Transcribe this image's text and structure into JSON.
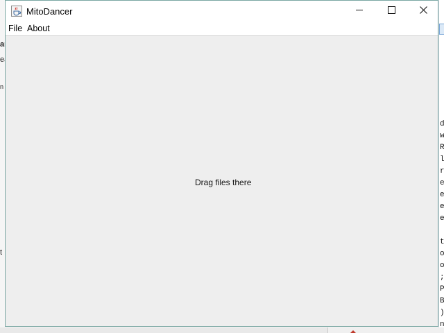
{
  "window": {
    "title": "MitoDancer",
    "app_icon": "java-cup-icon",
    "controls": {
      "minimize_icon": "minimize-icon",
      "maximize_icon": "maximize-icon",
      "close_icon": "close-icon"
    }
  },
  "menu": {
    "items": [
      {
        "label": "File"
      },
      {
        "label": "About"
      }
    ]
  },
  "main": {
    "drop_hint": "Drag files there"
  },
  "background": {
    "left_fragments": [
      "ar",
      "ea",
      "n",
      "t"
    ],
    "right_code_chars": [
      "d",
      "w",
      "R",
      "l",
      "r",
      "e",
      "e",
      "e",
      "e",
      "t",
      "o",
      "o",
      ";",
      "P",
      "B",
      ")",
      "n"
    ]
  },
  "colors": {
    "window_border": "#7aa7a3",
    "title_bar_bg": "#ffffff",
    "content_bg": "#eeeeee"
  }
}
